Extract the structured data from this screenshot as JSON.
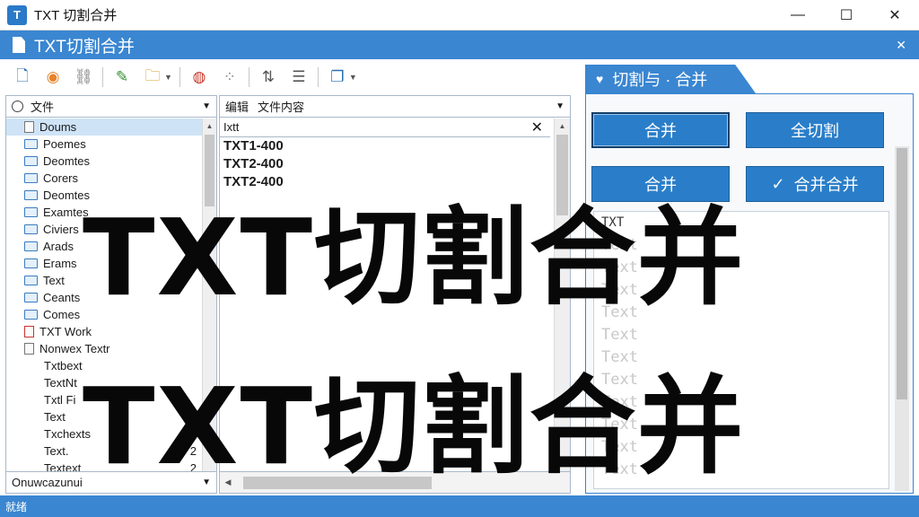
{
  "window": {
    "title": "TXT 切割合并",
    "minimize": "—",
    "maximize": "☐",
    "close": "✕"
  },
  "header": {
    "title": "TXT切割合并",
    "close": "✕"
  },
  "toolbar": {
    "icons": [
      "new-file-icon",
      "color-wheel-icon",
      "link-icon",
      "pencil-icon",
      "folder-icon",
      "apple-icon",
      "dots-icon",
      "arrows-icon",
      "align-icon",
      "windows-icon"
    ]
  },
  "tree": {
    "search_label": "文件",
    "items": [
      {
        "label": "Doums",
        "icon": "file",
        "selected": true
      },
      {
        "label": "Poemes",
        "icon": "folder"
      },
      {
        "label": "Deomtes",
        "icon": "folder"
      },
      {
        "label": "Corers",
        "icon": "folder"
      },
      {
        "label": "Deomtes",
        "icon": "folder"
      },
      {
        "label": "Examtes",
        "icon": "folder"
      },
      {
        "label": "Civiers",
        "icon": "folder"
      },
      {
        "label": "Arads",
        "icon": "folder"
      },
      {
        "label": "Erams",
        "icon": "folder"
      },
      {
        "label": "Text",
        "icon": "folder"
      },
      {
        "label": "Ceants",
        "icon": "folder"
      },
      {
        "label": "Comes",
        "icon": "folder"
      },
      {
        "label": "TXT Work",
        "icon": "file-red"
      },
      {
        "label": "Nonwex Textr",
        "icon": "file"
      },
      {
        "label": "Txtbext",
        "icon": "none",
        "num": ""
      },
      {
        "label": "TextNt",
        "icon": "none",
        "num": ""
      },
      {
        "label": "Txtl Fi",
        "icon": "none",
        "num": ""
      },
      {
        "label": "Text",
        "icon": "none",
        "num": "2"
      },
      {
        "label": "Txchexts",
        "icon": "none",
        "num": "1"
      },
      {
        "label": "Text.",
        "icon": "none",
        "num": "2"
      },
      {
        "label": "Textext",
        "icon": "none",
        "num": "2"
      }
    ],
    "status": "Onuwcazunui"
  },
  "middle": {
    "header_a": "编辑",
    "header_b": "文件内容",
    "sub_label": "Ixtt",
    "lines": [
      "TXT1-400",
      "TXT2-400",
      "TXT2-400"
    ]
  },
  "right": {
    "tab_label": "切割与 · 合并",
    "buttons": {
      "merge_top": "合并",
      "split_all": "全切割",
      "merge": "合并",
      "merge_merge": "合并合并",
      "check": "✓"
    },
    "list": [
      "TXT",
      "Text",
      "Text",
      "Text",
      "Text",
      "Text",
      "Text",
      "Text",
      "Text",
      "Text",
      "Text",
      "Text"
    ]
  },
  "statusbar": {
    "text": "就绪"
  },
  "overlay": {
    "line1": "TXT切割合并",
    "line2": "TXT切割合并"
  },
  "colors": {
    "accent": "#3a86d1",
    "button": "#2a7ec9"
  }
}
